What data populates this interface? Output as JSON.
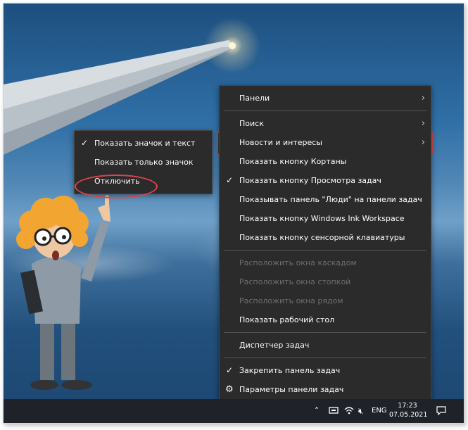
{
  "main_menu": {
    "items": [
      {
        "label": "Панели",
        "submenu": true,
        "checked": false,
        "disabled": false
      },
      {
        "label": "Поиск",
        "submenu": true,
        "checked": false,
        "disabled": false
      },
      {
        "label": "Новости и интересы",
        "submenu": true,
        "checked": false,
        "disabled": false,
        "highlighted": true
      },
      {
        "label": "Показать кнопку Кортаны",
        "submenu": false,
        "checked": false,
        "disabled": false
      },
      {
        "label": "Показать кнопку Просмотра задач",
        "submenu": false,
        "checked": true,
        "disabled": false
      },
      {
        "label": "Показывать панель \"Люди\" на панели задач",
        "submenu": false,
        "checked": false,
        "disabled": false
      },
      {
        "label": "Показать кнопку Windows Ink Workspace",
        "submenu": false,
        "checked": false,
        "disabled": false
      },
      {
        "label": "Показать кнопку сенсорной клавиатуры",
        "submenu": false,
        "checked": false,
        "disabled": false
      },
      {
        "label": "Расположить окна каскадом",
        "submenu": false,
        "checked": false,
        "disabled": true
      },
      {
        "label": "Расположить окна стопкой",
        "submenu": false,
        "checked": false,
        "disabled": true
      },
      {
        "label": "Расположить окна рядом",
        "submenu": false,
        "checked": false,
        "disabled": true
      },
      {
        "label": "Показать рабочий стол",
        "submenu": false,
        "checked": false,
        "disabled": false
      },
      {
        "label": "Диспетчер задач",
        "submenu": false,
        "checked": false,
        "disabled": false
      },
      {
        "label": "Закрепить панель задач",
        "submenu": false,
        "checked": true,
        "disabled": false
      },
      {
        "label": "Параметры панели задач",
        "submenu": false,
        "checked": false,
        "disabled": false,
        "icon": "gear-icon"
      }
    ]
  },
  "sub_menu": {
    "items": [
      {
        "label": "Показать значок и текст",
        "checked": true
      },
      {
        "label": "Показать только значок",
        "checked": false
      },
      {
        "label": "Отключить",
        "checked": false,
        "circled": true
      }
    ]
  },
  "taskbar": {
    "language": "ENG",
    "time": "17:23",
    "date": "07.05.2021",
    "tray_icons": [
      "chevron-up-icon",
      "network-icon",
      "wifi-icon",
      "volume-mute-icon",
      "notification-icon"
    ]
  },
  "colors": {
    "highlight_border": "#e0434c",
    "menu_bg": "#2b2b2b",
    "taskbar_bg": "#1f2329"
  }
}
